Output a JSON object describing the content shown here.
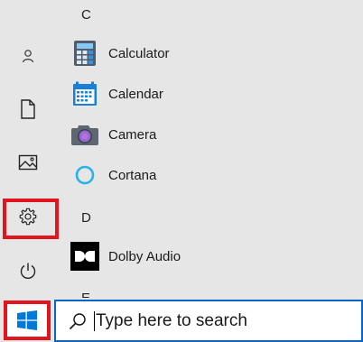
{
  "rail": {
    "items": [
      {
        "name": "user-account",
        "icon": "person-icon"
      },
      {
        "name": "documents",
        "icon": "document-icon"
      },
      {
        "name": "pictures",
        "icon": "pictures-icon"
      },
      {
        "name": "settings",
        "icon": "gear-icon"
      },
      {
        "name": "power",
        "icon": "power-icon"
      }
    ]
  },
  "applist": {
    "sections": [
      {
        "letter": "C",
        "apps": [
          {
            "label": "Calculator",
            "icon": "calculator-icon"
          },
          {
            "label": "Calendar",
            "icon": "calendar-icon"
          },
          {
            "label": "Camera",
            "icon": "camera-icon"
          },
          {
            "label": "Cortana",
            "icon": "cortana-icon"
          }
        ]
      },
      {
        "letter": "D",
        "apps": [
          {
            "label": "Dolby Audio",
            "icon": "dolby-icon"
          }
        ]
      },
      {
        "letter": "E",
        "apps": []
      }
    ]
  },
  "taskbar": {
    "start_icon": "windows-logo-icon",
    "search_placeholder": "Type here to search"
  },
  "colors": {
    "accent": "#0078d7",
    "highlight": "#e2141c",
    "background": "#e6e6e6"
  }
}
